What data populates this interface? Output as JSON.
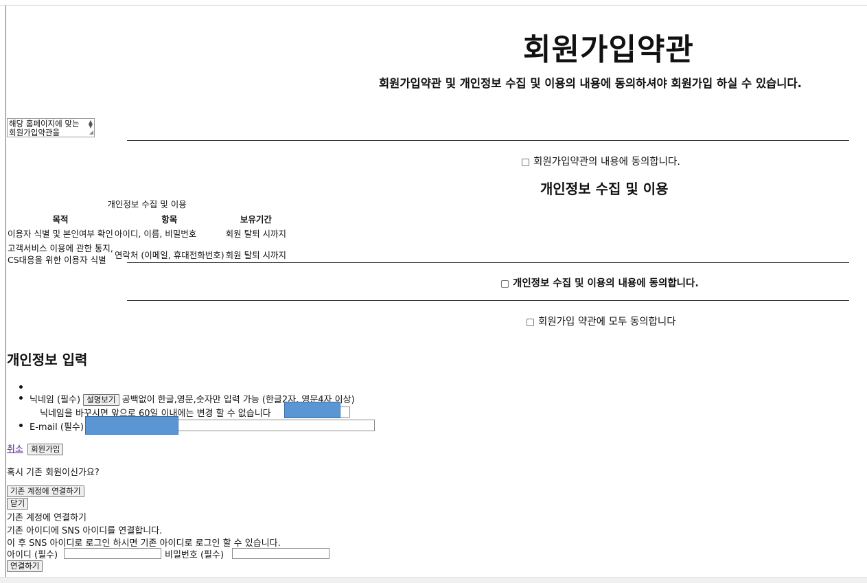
{
  "header": {
    "title": "회원가입약관",
    "subtitle": "회원가입약관 및 개인정보 수집 및 이용의 내용에 동의하셔야 회원가입 하실 수 있습니다."
  },
  "terms": {
    "textarea_text": "해당 홈페이지에 맞는 회원가입약관을 입력하세요.",
    "agree_label": "회원가입약관의 내용에 동의합니다."
  },
  "privacy": {
    "section_title": "개인정보 수집 및 이용",
    "table_caption": "개인정보 수집 및 이용",
    "columns": [
      "목적",
      "항목",
      "보유기간"
    ],
    "rows": [
      [
        "이용자 식별 및 본인여부 확인",
        "아이디, 이름, 비밀번호",
        "회원 탈퇴 시까지"
      ],
      [
        "고객서비스 이용에 관한 통지, CS대응을 위한 이용자 식별",
        "연락처 (이메일, 휴대전화번호)",
        "회원 탈퇴 시까지"
      ]
    ],
    "row2_purpose_line1": "고객서비스 이용에 관한 통지,",
    "row2_purpose_line2": "CS대응을 위한 이용자 식별",
    "agree_label": "개인정보 수집 및 이용의 내용에 동의합니다."
  },
  "agree_all_label": "회원가입 약관에 모두 동의합니다",
  "form": {
    "section_title": "개인정보 입력",
    "nickname_label": "닉네임 (필수)",
    "nickname_help_button": "설명보기",
    "nickname_help": "공백없이 한글,영문,숫자만 입력 가능 (한글2자, 영문4자 이상)",
    "nickname_notice": "닉네임을 바꾸시면 앞으로 60일 이내에는 변경 할 수 없습니다",
    "email_label": "E-mail (필수)",
    "cancel_link": "취소",
    "submit_button": "회원가입"
  },
  "existing": {
    "question": "혹시 기존 회원이신가요?",
    "connect_toggle_button": "기존 계정에 연결하기",
    "close_button": "닫기",
    "panel_title": "기존 계정에 연결하기",
    "desc1": "기존 아이디에 SNS 아이디를 연결합니다.",
    "desc2": "이 후 SNS 아이디로 로그인 하시면 기존 아이디로 로그인 할 수 있습니다.",
    "id_label": "아이디 (필수)",
    "password_label": "비밀번호 (필수)",
    "connect_button": "연결하기"
  },
  "colors": {
    "redaction": "#5b96d4",
    "link_visited": "#551a8b",
    "left_rule": "#d9333f"
  }
}
